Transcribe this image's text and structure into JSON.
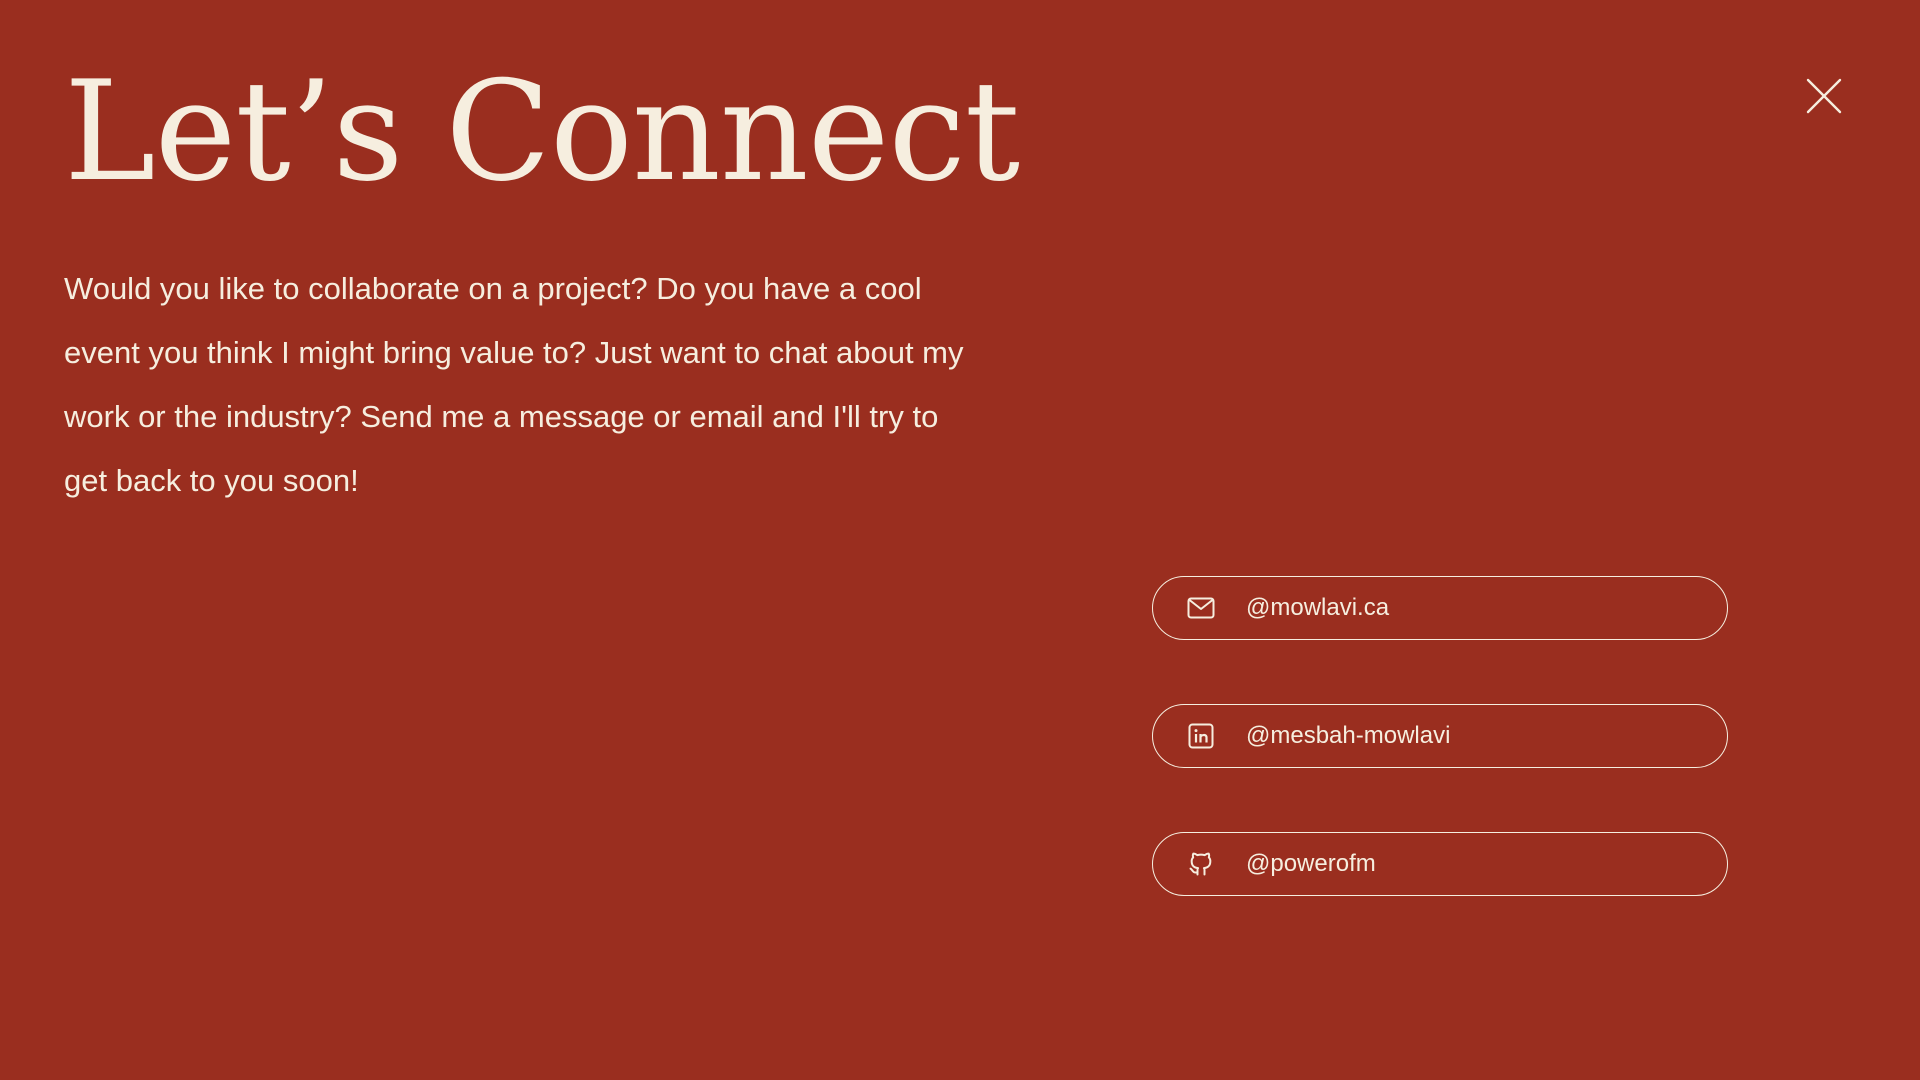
{
  "header": {
    "title": "Let’s Connect",
    "close_icon": "close-icon"
  },
  "intro": {
    "text": "Would you like to collaborate on a project? Do you have a cool event you think I might bring value to? Just want to chat about my work or the industry? Send me a message or email and I'll try to get back to you soon!"
  },
  "contacts": [
    {
      "icon": "mail-icon",
      "label": "@mowlavi.ca"
    },
    {
      "icon": "linkedin-icon",
      "label": "@mesbah-mowlavi"
    },
    {
      "icon": "github-icon",
      "label": "@powerofm"
    }
  ],
  "colors": {
    "background": "#9a2e1f",
    "foreground": "#f6eedf"
  }
}
